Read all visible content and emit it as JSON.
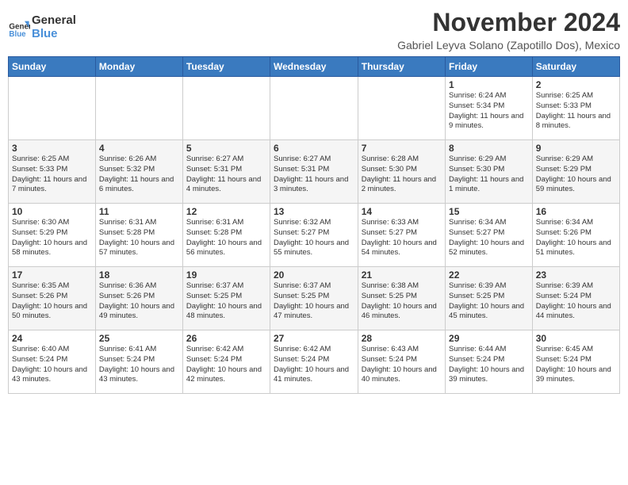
{
  "header": {
    "logo_line1": "General",
    "logo_line2": "Blue",
    "month_year": "November 2024",
    "location": "Gabriel Leyva Solano (Zapotillo Dos), Mexico"
  },
  "weekdays": [
    "Sunday",
    "Monday",
    "Tuesday",
    "Wednesday",
    "Thursday",
    "Friday",
    "Saturday"
  ],
  "weeks": [
    [
      {
        "day": "",
        "info": ""
      },
      {
        "day": "",
        "info": ""
      },
      {
        "day": "",
        "info": ""
      },
      {
        "day": "",
        "info": ""
      },
      {
        "day": "",
        "info": ""
      },
      {
        "day": "1",
        "info": "Sunrise: 6:24 AM\nSunset: 5:34 PM\nDaylight: 11 hours and 9 minutes."
      },
      {
        "day": "2",
        "info": "Sunrise: 6:25 AM\nSunset: 5:33 PM\nDaylight: 11 hours and 8 minutes."
      }
    ],
    [
      {
        "day": "3",
        "info": "Sunrise: 6:25 AM\nSunset: 5:33 PM\nDaylight: 11 hours and 7 minutes."
      },
      {
        "day": "4",
        "info": "Sunrise: 6:26 AM\nSunset: 5:32 PM\nDaylight: 11 hours and 6 minutes."
      },
      {
        "day": "5",
        "info": "Sunrise: 6:27 AM\nSunset: 5:31 PM\nDaylight: 11 hours and 4 minutes."
      },
      {
        "day": "6",
        "info": "Sunrise: 6:27 AM\nSunset: 5:31 PM\nDaylight: 11 hours and 3 minutes."
      },
      {
        "day": "7",
        "info": "Sunrise: 6:28 AM\nSunset: 5:30 PM\nDaylight: 11 hours and 2 minutes."
      },
      {
        "day": "8",
        "info": "Sunrise: 6:29 AM\nSunset: 5:30 PM\nDaylight: 11 hours and 1 minute."
      },
      {
        "day": "9",
        "info": "Sunrise: 6:29 AM\nSunset: 5:29 PM\nDaylight: 10 hours and 59 minutes."
      }
    ],
    [
      {
        "day": "10",
        "info": "Sunrise: 6:30 AM\nSunset: 5:29 PM\nDaylight: 10 hours and 58 minutes."
      },
      {
        "day": "11",
        "info": "Sunrise: 6:31 AM\nSunset: 5:28 PM\nDaylight: 10 hours and 57 minutes."
      },
      {
        "day": "12",
        "info": "Sunrise: 6:31 AM\nSunset: 5:28 PM\nDaylight: 10 hours and 56 minutes."
      },
      {
        "day": "13",
        "info": "Sunrise: 6:32 AM\nSunset: 5:27 PM\nDaylight: 10 hours and 55 minutes."
      },
      {
        "day": "14",
        "info": "Sunrise: 6:33 AM\nSunset: 5:27 PM\nDaylight: 10 hours and 54 minutes."
      },
      {
        "day": "15",
        "info": "Sunrise: 6:34 AM\nSunset: 5:27 PM\nDaylight: 10 hours and 52 minutes."
      },
      {
        "day": "16",
        "info": "Sunrise: 6:34 AM\nSunset: 5:26 PM\nDaylight: 10 hours and 51 minutes."
      }
    ],
    [
      {
        "day": "17",
        "info": "Sunrise: 6:35 AM\nSunset: 5:26 PM\nDaylight: 10 hours and 50 minutes."
      },
      {
        "day": "18",
        "info": "Sunrise: 6:36 AM\nSunset: 5:26 PM\nDaylight: 10 hours and 49 minutes."
      },
      {
        "day": "19",
        "info": "Sunrise: 6:37 AM\nSunset: 5:25 PM\nDaylight: 10 hours and 48 minutes."
      },
      {
        "day": "20",
        "info": "Sunrise: 6:37 AM\nSunset: 5:25 PM\nDaylight: 10 hours and 47 minutes."
      },
      {
        "day": "21",
        "info": "Sunrise: 6:38 AM\nSunset: 5:25 PM\nDaylight: 10 hours and 46 minutes."
      },
      {
        "day": "22",
        "info": "Sunrise: 6:39 AM\nSunset: 5:25 PM\nDaylight: 10 hours and 45 minutes."
      },
      {
        "day": "23",
        "info": "Sunrise: 6:39 AM\nSunset: 5:24 PM\nDaylight: 10 hours and 44 minutes."
      }
    ],
    [
      {
        "day": "24",
        "info": "Sunrise: 6:40 AM\nSunset: 5:24 PM\nDaylight: 10 hours and 43 minutes."
      },
      {
        "day": "25",
        "info": "Sunrise: 6:41 AM\nSunset: 5:24 PM\nDaylight: 10 hours and 43 minutes."
      },
      {
        "day": "26",
        "info": "Sunrise: 6:42 AM\nSunset: 5:24 PM\nDaylight: 10 hours and 42 minutes."
      },
      {
        "day": "27",
        "info": "Sunrise: 6:42 AM\nSunset: 5:24 PM\nDaylight: 10 hours and 41 minutes."
      },
      {
        "day": "28",
        "info": "Sunrise: 6:43 AM\nSunset: 5:24 PM\nDaylight: 10 hours and 40 minutes."
      },
      {
        "day": "29",
        "info": "Sunrise: 6:44 AM\nSunset: 5:24 PM\nDaylight: 10 hours and 39 minutes."
      },
      {
        "day": "30",
        "info": "Sunrise: 6:45 AM\nSunset: 5:24 PM\nDaylight: 10 hours and 39 minutes."
      }
    ]
  ]
}
